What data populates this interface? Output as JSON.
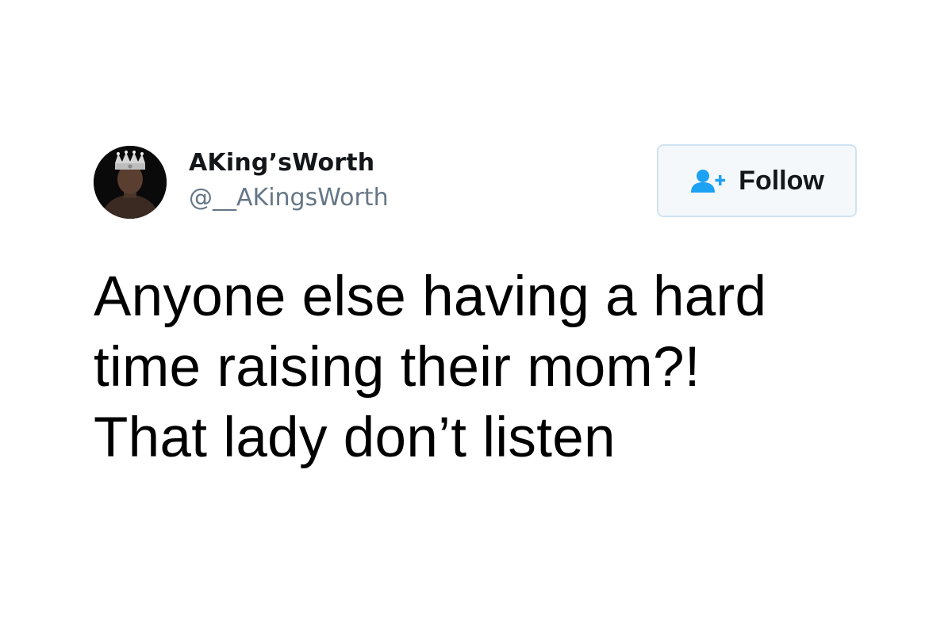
{
  "author": {
    "display_name": "AKing’sWorth",
    "handle": "@__AKingsWorth",
    "avatar_icon": "profile-photo-crowned-man"
  },
  "follow_button": {
    "label": "Follow",
    "icon": "add-user-icon",
    "accent": "#1da1f2"
  },
  "tweet": {
    "text": "Anyone else having a hard\ntime raising their mom?!\nThat lady don’t listen"
  }
}
